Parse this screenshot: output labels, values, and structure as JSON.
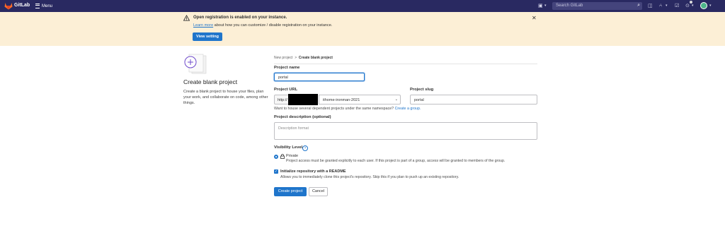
{
  "topbar": {
    "brand": "GitLab",
    "menu_label": "Menu",
    "search_placeholder": "Search GitLab",
    "icons": [
      "plus-square-icon",
      "search-icon",
      "todo-icon",
      "merge-request-icon",
      "issues-icon",
      "help-icon",
      "user-avatar"
    ]
  },
  "alert": {
    "title": "Open registration is enabled on your instance.",
    "link_text": "Learn more",
    "body_rest": " about how you can customize / disable registration on your instance.",
    "button": "View setting"
  },
  "sidebar": {
    "title": "Create blank project",
    "description": "Create a blank project to house your files, plan your work, and collaborate on code, among other things."
  },
  "breadcrumb": {
    "first": "New project",
    "separator": ">",
    "current": "Create blank project"
  },
  "form": {
    "project_name_label": "Project name",
    "project_name_value": "portal",
    "project_url_label": "Project URL",
    "url_prefix": "http://",
    "namespace_value": "ithome-ironman-2021",
    "project_slug_label": "Project slug",
    "project_slug_value": "portal",
    "hint_text": "Want to house several dependent projects under the same namespace? ",
    "hint_link": "Create a group.",
    "description_label": "Project description (optional)",
    "description_placeholder": "Description format",
    "visibility_label": "Visibility Level",
    "visibility_option_title": "Private",
    "visibility_option_desc": "Project access must be granted explicitly to each user. If this project is part of a group, access will be granted to members of the group.",
    "readme_title": "Initialize repository with a README",
    "readme_desc": "Allows you to immediately clone this project's repository. Skip this if you plan to push up an existing repository.",
    "create_button": "Create project",
    "cancel_button": "Cancel"
  },
  "colors": {
    "topbar": "#292961",
    "primary": "#1f75cb",
    "alert_bg": "#fcefd6",
    "illustration": "#6e49cb"
  }
}
